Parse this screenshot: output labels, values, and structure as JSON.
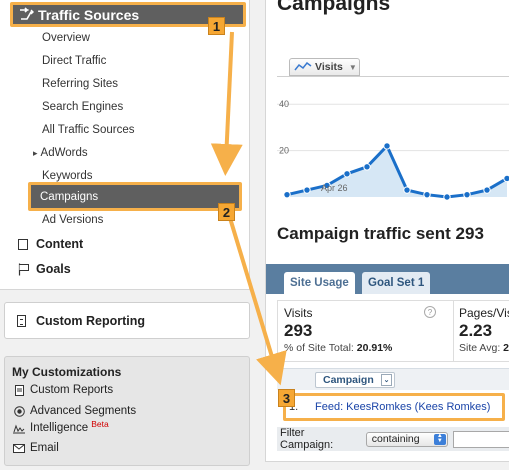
{
  "sidebar": {
    "traffic_sources_label": "Traffic Sources",
    "items": [
      {
        "label": "Overview"
      },
      {
        "label": "Direct Traffic"
      },
      {
        "label": "Referring Sites"
      },
      {
        "label": "Search Engines"
      },
      {
        "label": "All Traffic Sources"
      },
      {
        "label": "AdWords"
      },
      {
        "label": "Keywords"
      }
    ],
    "selected_label": "Campaigns",
    "ad_versions_label": "Ad Versions",
    "content_label": "Content",
    "goals_label": "Goals"
  },
  "custom_reporting": {
    "label": "Custom Reporting"
  },
  "customizations": {
    "title": "My Customizations",
    "items": [
      {
        "label": "Custom Reports"
      },
      {
        "label": "Advanced Segments"
      },
      {
        "label": "Intelligence"
      },
      {
        "label": "Email"
      }
    ],
    "beta_label": "Beta"
  },
  "main": {
    "title": "Campaigns",
    "metric_selector": "Visits",
    "heading": "Campaign traffic sent 293",
    "tabs": [
      {
        "label": "Site Usage"
      },
      {
        "label": "Goal Set 1"
      }
    ],
    "stats": [
      {
        "label": "Visits",
        "value": "293",
        "sub_prefix": "% of Site Total: ",
        "sub_value": "20.91%"
      },
      {
        "label": "Pages/Vis",
        "value": "2.23",
        "sub_prefix": "Site Avg: ",
        "sub_value": "2"
      }
    ],
    "table": {
      "column_header": "Campaign",
      "rows": [
        {
          "index": "1.",
          "campaign": "Feed: KeesRomkes (Kees Romkes)"
        }
      ]
    },
    "filter": {
      "label": "Filter Campaign:",
      "option": "containing",
      "value": ""
    }
  },
  "chart_data": {
    "type": "line",
    "y_tick_labels": [
      "40",
      "20"
    ],
    "x_tick_labels": [
      "Apr 26"
    ],
    "ylim": [
      0,
      50
    ],
    "series": [
      {
        "values": [
          1,
          3,
          5,
          10,
          13,
          22,
          3,
          1,
          0,
          1,
          3,
          8
        ]
      }
    ],
    "color": "#1a6fc9",
    "fill": "#d6e7f5"
  },
  "annotations": {
    "steps": [
      "1",
      "2",
      "3"
    ],
    "color": "#f6b04a"
  }
}
